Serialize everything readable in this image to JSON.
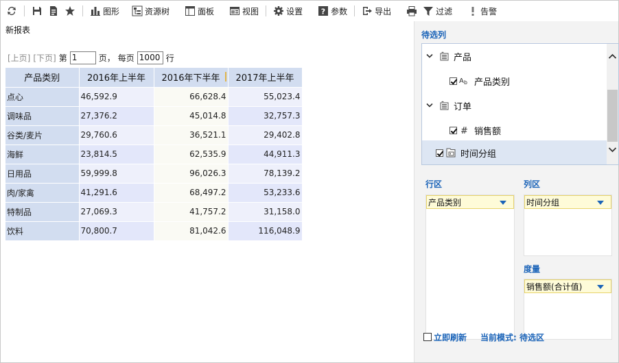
{
  "toolbar": {
    "refresh": "refresh-icon",
    "save": "save-icon",
    "save_as": "save-as-icon",
    "favorite": "star-icon",
    "chart_label": "图形",
    "resource_tree_label": "资源树",
    "panel_label": "面板",
    "view_label": "视图",
    "settings_label": "设置",
    "params_label": "参数",
    "export_label": "导出",
    "print": "print-icon",
    "filter_label": "过滤",
    "alert_label": "告警"
  },
  "report": {
    "title": "新报表"
  },
  "pager": {
    "prev": "[上页]",
    "next": "[下页]",
    "page_prefix": "第",
    "page_value": "1",
    "page_suffix": "页，",
    "per_page_prefix": "每页",
    "per_page_value": "1000",
    "per_page_suffix": "行"
  },
  "table": {
    "headers": [
      "产品类别",
      "2016年上半年",
      "2016年下半年",
      "2017年上半年"
    ],
    "rows": [
      [
        "点心",
        "46,592.9",
        "66,628.4",
        "55,023.4"
      ],
      [
        "调味品",
        "27,376.2",
        "45,014.8",
        "32,757.3"
      ],
      [
        "谷类/麦片",
        "29,760.6",
        "36,521.1",
        "29,402.8"
      ],
      [
        "海鲜",
        "23,814.5",
        "62,535.9",
        "44,911.3"
      ],
      [
        "日用品",
        "59,999.8",
        "96,026.3",
        "78,139.2"
      ],
      [
        "肉/家禽",
        "41,291.6",
        "68,497.2",
        "53,233.6"
      ],
      [
        "特制品",
        "27,069.3",
        "41,757.2",
        "31,158.0"
      ],
      [
        "饮料",
        "70,800.7",
        "81,042.6",
        "116,048.9"
      ]
    ]
  },
  "panel": {
    "candidates_title": "待选列",
    "tree": [
      {
        "label": "产品",
        "level": 0,
        "type": "folder"
      },
      {
        "label": "产品类别",
        "level": 1,
        "type": "text-field",
        "checked": true
      },
      {
        "label": "订单",
        "level": 0,
        "type": "folder"
      },
      {
        "label": "销售额",
        "level": 1,
        "type": "number-field",
        "checked": true
      },
      {
        "label": "时间分组",
        "level": 0,
        "type": "date-group",
        "checked": true,
        "selected": true
      }
    ],
    "row_area_title": "行区",
    "row_field": "产品类别",
    "col_area_title": "列区",
    "col_field": "时间分组",
    "measure_title": "度量",
    "measure_field": "销售额(合计值)",
    "refresh_now": "立即刷新",
    "mode_label": "当前模式: 待选区"
  },
  "colors": {
    "accent": "#1a63b8",
    "header_bg": "#d2ddf0",
    "chip_bg": "#fefbd8"
  }
}
